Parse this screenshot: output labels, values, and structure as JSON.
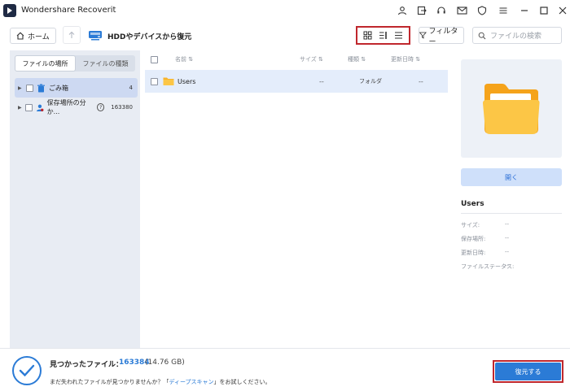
{
  "app": {
    "title": "Wondershare Recoverit"
  },
  "titlebar_icons": [
    "user-icon",
    "exit-icon",
    "headset-icon",
    "mail-icon",
    "shield-icon",
    "menu-icon",
    "minimize-icon",
    "maximize-icon",
    "close-icon"
  ],
  "toolbar": {
    "home_label": "ホーム",
    "location_title": "HDDやデバイスから復元",
    "view_modes": [
      "grid-view-icon",
      "detail-view-icon",
      "list-view-icon"
    ],
    "filter_label": "フィルター",
    "search_placeholder": "ファイルの検索"
  },
  "sidebar": {
    "tabs": [
      {
        "label": "ファイルの場所",
        "active": true
      },
      {
        "label": "ファイルの種類",
        "active": false
      }
    ],
    "items": [
      {
        "label": "ごみ箱",
        "count": "4",
        "icon": "trash-icon",
        "selected": true
      },
      {
        "label": "保存場所の分か...",
        "count": "163380",
        "icon": "user-location-icon",
        "selected": false
      }
    ]
  },
  "file_list": {
    "columns": [
      "名前",
      "サイズ",
      "種類",
      "更新日時"
    ],
    "rows": [
      {
        "name": "Users",
        "size": "--",
        "type": "フォルダ",
        "modified": "--"
      }
    ]
  },
  "details": {
    "open_label": "開く",
    "name": "Users",
    "properties": [
      {
        "label": "サイズ:",
        "value": "--"
      },
      {
        "label": "保存場所:",
        "value": "--"
      },
      {
        "label": "更新日時:",
        "value": "--"
      },
      {
        "label": "ファイルステータス:",
        "value": "--"
      }
    ]
  },
  "footer": {
    "found_label": "見つかったファイル：",
    "found_count": "163384",
    "found_size": "(14.76 GB)",
    "hint_prefix": "まだ失われたファイルが見つかりませんか？「",
    "deep_scan_link": "ディープスキャン",
    "hint_suffix": "」をお試しください。",
    "restore_label": "復元する"
  },
  "colors": {
    "accent": "#2b7bd6",
    "highlight": "#c0272d",
    "folder": "#f7b32b"
  }
}
